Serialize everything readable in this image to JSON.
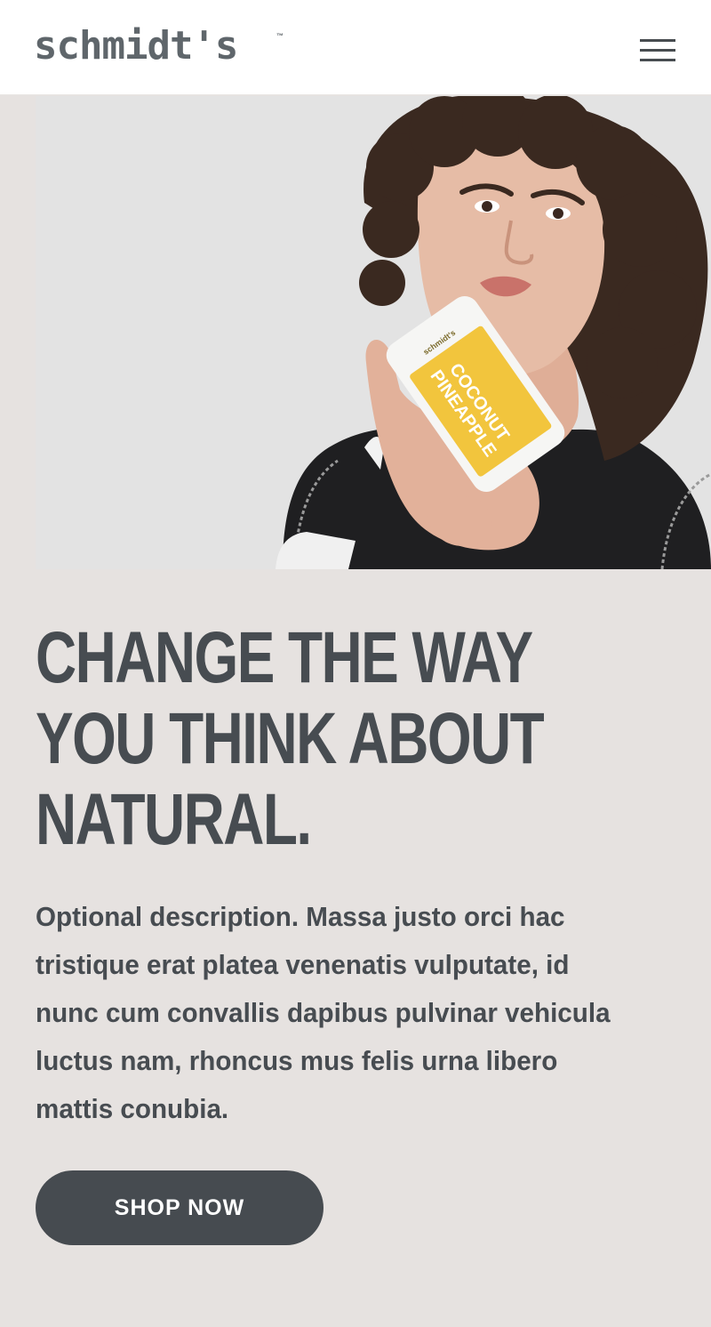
{
  "header": {
    "logo_text": "schmidt's",
    "logo_tm": "™",
    "menu_icon": "hamburger-menu-icon"
  },
  "hero": {
    "product_label_line1": "COCONUT",
    "product_label_line2": "PINEAPPLE",
    "product_brand": "schmidt's",
    "colors": {
      "background": "#e3e3e3",
      "label": "#f2c53d",
      "sweater": "#1e1e20",
      "hair": "#3b2a22",
      "skin": "#e4b9a3"
    }
  },
  "main": {
    "headline_lines": [
      "CHANGE THE WAY",
      "YOU THINK ABOUT",
      "NATURAL."
    ],
    "description": "Optional description. Massa justo orci hac tristique erat platea venenatis vulputate, id nunc cum convallis dapibus pulvinar vehicula luctus nam, rhoncus mus felis urna libero mattis conubia.",
    "cta_label": "SHOP NOW"
  },
  "colors": {
    "page_background": "#e6e2e0",
    "text": "#474c51",
    "button": "#464b50",
    "button_text": "#ffffff"
  }
}
